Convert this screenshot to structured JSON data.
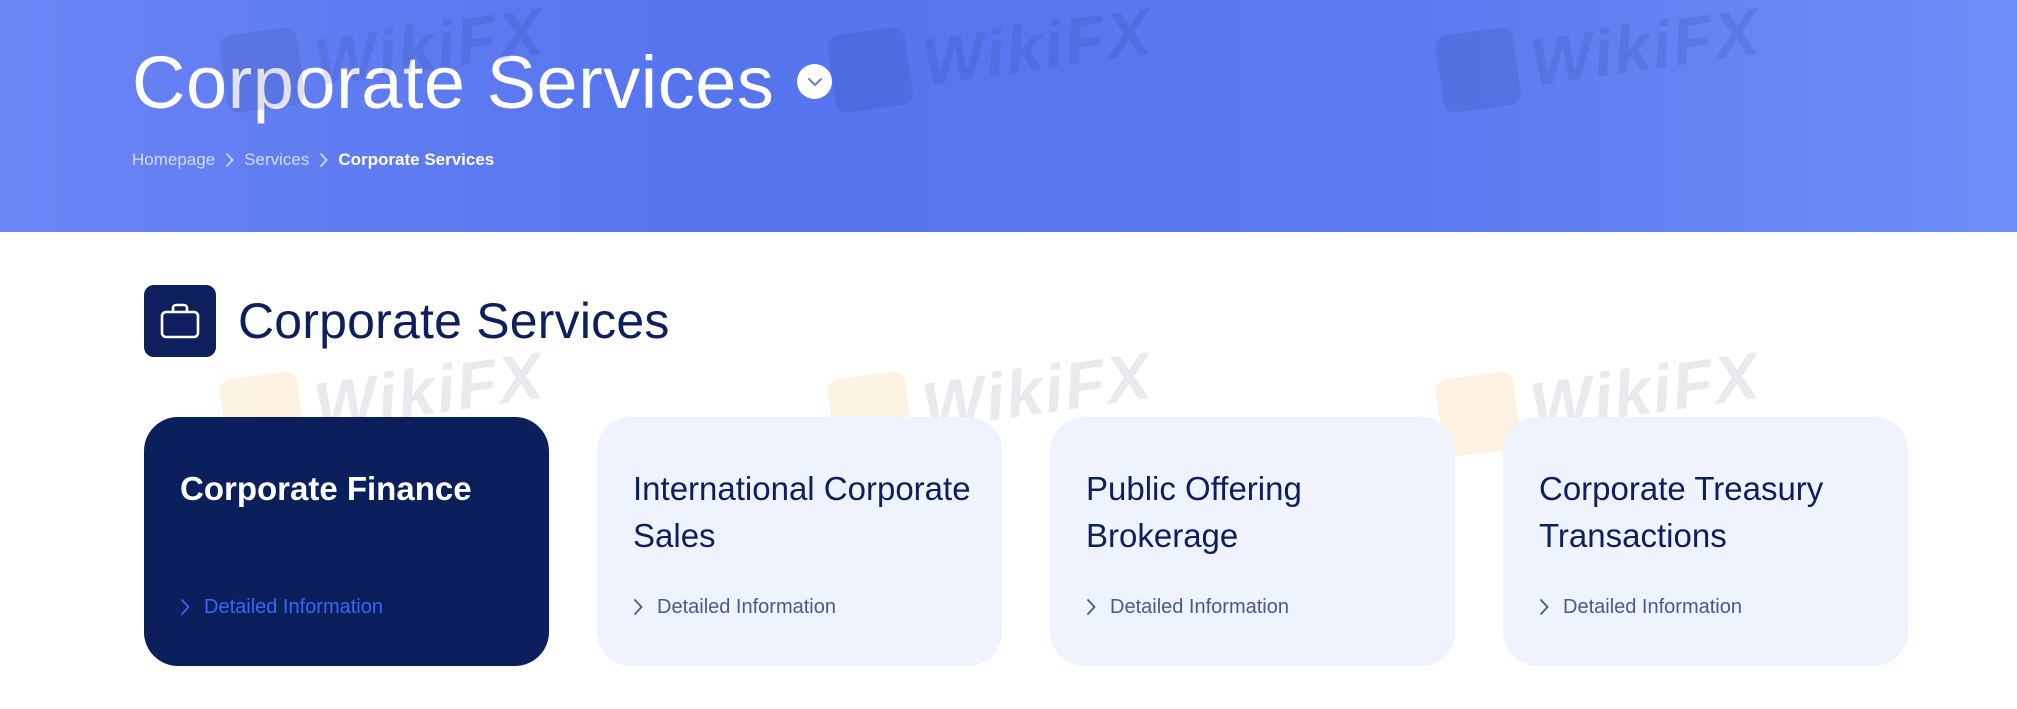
{
  "hero": {
    "title": "Corporate Services",
    "breadcrumb": [
      {
        "label": "Homepage"
      },
      {
        "label": "Services"
      },
      {
        "label": "Corporate Services"
      }
    ]
  },
  "section": {
    "icon": "briefcase-icon",
    "title": "Corporate Services"
  },
  "cards": [
    {
      "title": "Corporate Finance",
      "link": "Detailed Information",
      "active": true
    },
    {
      "title": "International Corporate Sales",
      "link": "Detailed Information",
      "active": false
    },
    {
      "title": "Public Offering Brokerage",
      "link": "Detailed Information",
      "active": false
    },
    {
      "title": "Corporate Treasury Transactions",
      "link": "Detailed Information",
      "active": false
    }
  ],
  "watermark": {
    "text": "WikiFX"
  },
  "colors": {
    "hero_gradient_start": "#6b84f6",
    "hero_gradient_mid": "#5574ee",
    "navy": "#0b1f5c",
    "card_bg": "#eef3fd",
    "active_link": "#3a66f2"
  }
}
